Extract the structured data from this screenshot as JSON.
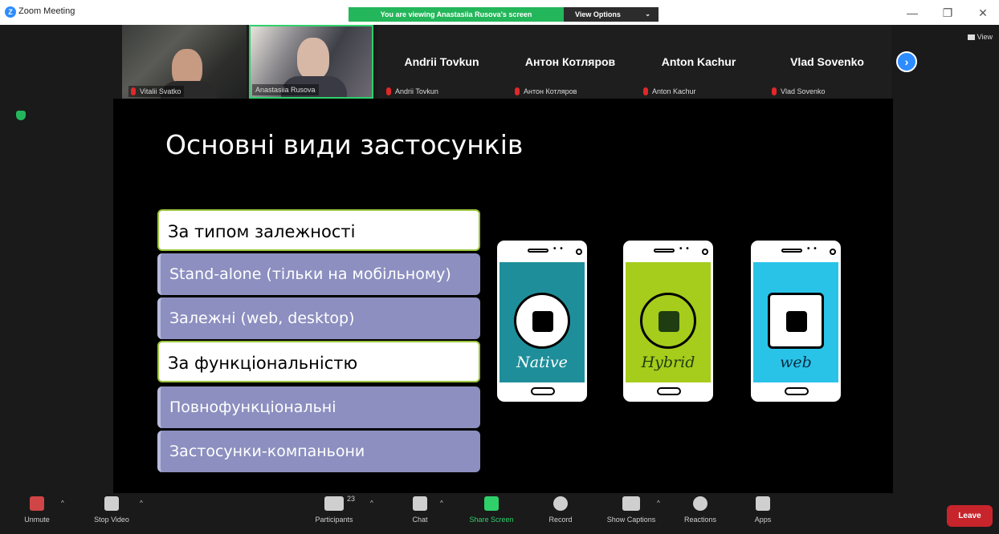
{
  "window": {
    "title": "Zoom Meeting",
    "viewing_banner": "You are viewing Anastasiia Rusova's screen",
    "view_options": "View Options",
    "view_toggle": "View",
    "controls": [
      "—",
      "❐",
      "✕"
    ]
  },
  "gallery": {
    "tiles": [
      {
        "label": "Vitalii Svatko",
        "type": "video"
      },
      {
        "label": "Anastasiia Rusova",
        "type": "video",
        "active_speaker": true
      },
      {
        "name": "Andrii Tovkun",
        "label": "Andrii Tovkun"
      },
      {
        "name": "Антон Котляров",
        "label": "Антон Котляров"
      },
      {
        "name": "Anton Kachur",
        "label": "Anton Kachur"
      },
      {
        "name": "Vlad Sovenko",
        "label": "Vlad Sovenko"
      }
    ],
    "next_icon": "chevron-right-icon"
  },
  "slide": {
    "title": "Основні види застосунків",
    "boxes": [
      {
        "text": "За типом залежності",
        "kind": "head"
      },
      {
        "text": "Stand-alone (тільки на мобільному)",
        "kind": "sub"
      },
      {
        "text": "Залежні (web, desktop)",
        "kind": "sub"
      },
      {
        "text": "За функціональністю",
        "kind": "head"
      },
      {
        "text": "Повнофункціональні",
        "kind": "sub"
      },
      {
        "text": "Застосунки-компаньони",
        "kind": "sub"
      }
    ],
    "phones": [
      {
        "caption": "Native",
        "screen_color": "#1e8f9a",
        "caption_color": "#ffffff"
      },
      {
        "caption": "Hybrid",
        "screen_color": "#a6cc1c",
        "caption_color": "#1f3d10"
      },
      {
        "caption": "web",
        "screen_color": "#29c3e8",
        "caption_color": "#0a2a40"
      }
    ]
  },
  "toolbar": {
    "items": [
      {
        "label": "Unmute",
        "icon": "microphone-muted-icon",
        "caret": true
      },
      {
        "label": "Stop Video",
        "icon": "video-camera-icon",
        "caret": true
      },
      {
        "label": "Participants",
        "icon": "participants-icon",
        "count": "23",
        "caret": true
      },
      {
        "label": "Chat",
        "icon": "chat-icon",
        "caret": true
      },
      {
        "label": "Share Screen",
        "icon": "share-screen-icon",
        "caret": false
      },
      {
        "label": "Record",
        "icon": "record-icon",
        "caret": false
      },
      {
        "label": "Show Captions",
        "icon": "captions-icon",
        "caret": true
      },
      {
        "label": "Reactions",
        "icon": "reactions-icon",
        "caret": false
      },
      {
        "label": "Apps",
        "icon": "apps-icon",
        "caret": false
      }
    ],
    "leave": "Leave"
  },
  "colors": {
    "share_green": "#2fd06a",
    "leave_red": "#c7252b",
    "zoom_blue": "#2d8cff",
    "slide_box_purple": "#8c8fbf"
  }
}
